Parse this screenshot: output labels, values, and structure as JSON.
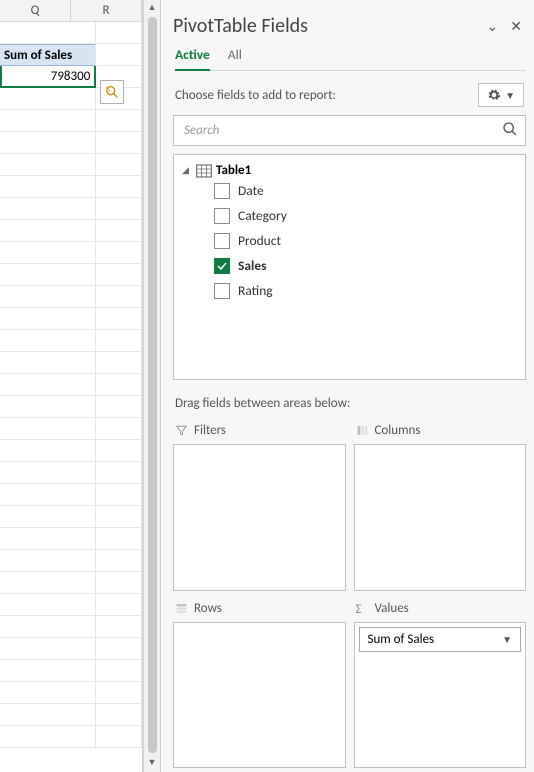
{
  "sheet": {
    "columns": [
      "Q",
      "R"
    ],
    "pivot_label": "Sum of Sales",
    "pivot_value": "798300"
  },
  "pane": {
    "title": "PivotTable Fields",
    "tabs": {
      "active": "Active",
      "all": "All"
    },
    "hint": "Choose fields to add to report:",
    "search_placeholder": "Search",
    "table_name": "Table1",
    "fields": {
      "date": "Date",
      "category": "Category",
      "product": "Product",
      "sales": "Sales",
      "rating": "Rating"
    },
    "drag_text": "Drag fields between areas below:",
    "areas": {
      "filters": "Filters",
      "columns": "Columns",
      "rows": "Rows",
      "values": "Values"
    },
    "value_item": "Sum of Sales"
  }
}
